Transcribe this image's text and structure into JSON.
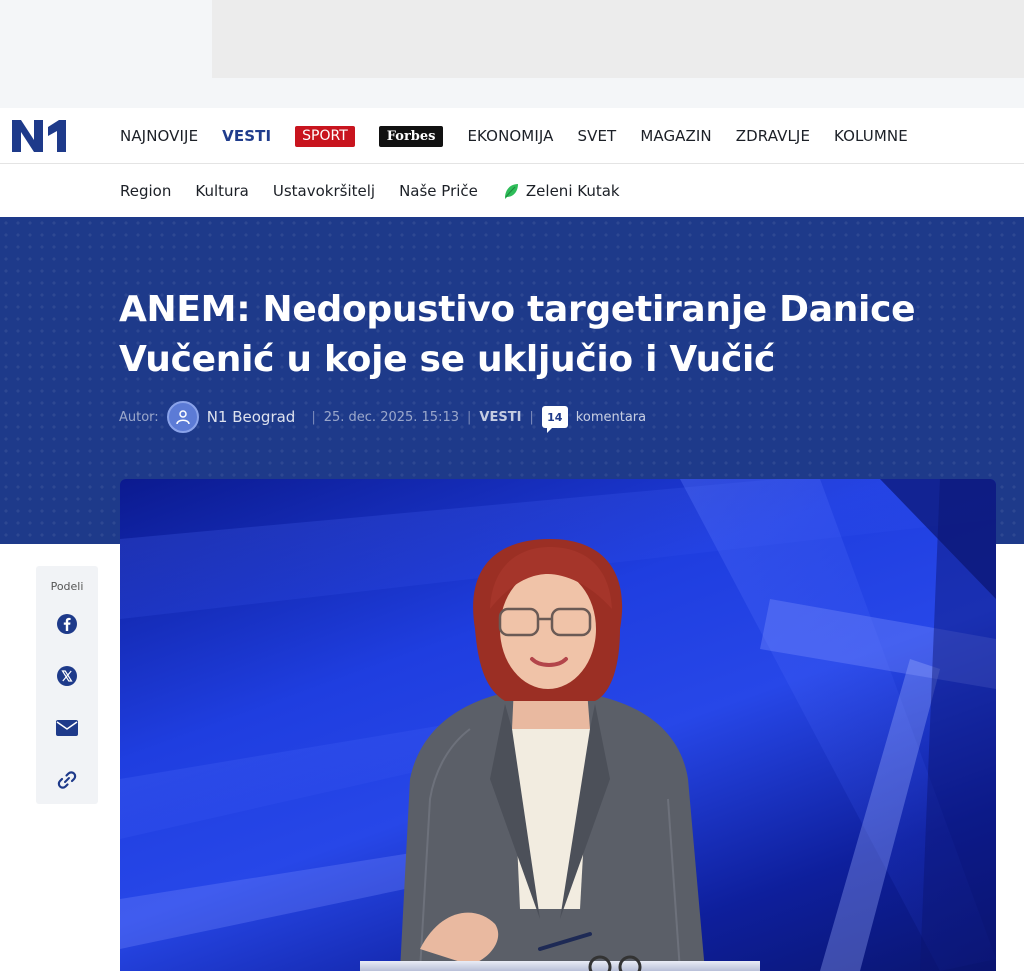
{
  "brand": {
    "logo_text": "N1"
  },
  "main_nav": {
    "items": [
      {
        "label": "NAJNOVIJE"
      },
      {
        "label": "VESTI"
      },
      {
        "label": "SPORT"
      },
      {
        "label": "Forbes"
      },
      {
        "label": "EKONOMIJA"
      },
      {
        "label": "SVET"
      },
      {
        "label": "MAGAZIN"
      },
      {
        "label": "ZDRAVLJE"
      },
      {
        "label": "KOLUMNE"
      }
    ]
  },
  "sub_nav": {
    "items": [
      {
        "label": "Region"
      },
      {
        "label": "Kultura"
      },
      {
        "label": "Ustavokršitelj"
      },
      {
        "label": "Naše Priče"
      },
      {
        "label": "Zeleni Kutak"
      }
    ]
  },
  "article": {
    "headline": "ANEM: Nedopustivo targetiranje Danice Vučenić u koje se uključio i Vučić",
    "author_label": "Autor:",
    "author_name": "N1 Beograd",
    "date": "25. dec. 2025. 15:13",
    "category": "VESTI",
    "comments_count": "14",
    "comments_label": "komentara"
  },
  "share": {
    "label": "Podeli",
    "buttons": [
      "facebook-icon",
      "x-icon",
      "mail-icon",
      "link-icon"
    ]
  },
  "colors": {
    "brand_blue": "#1e3a8a",
    "sport_red": "#c8141e",
    "active_nav": "#1f3c8c"
  }
}
